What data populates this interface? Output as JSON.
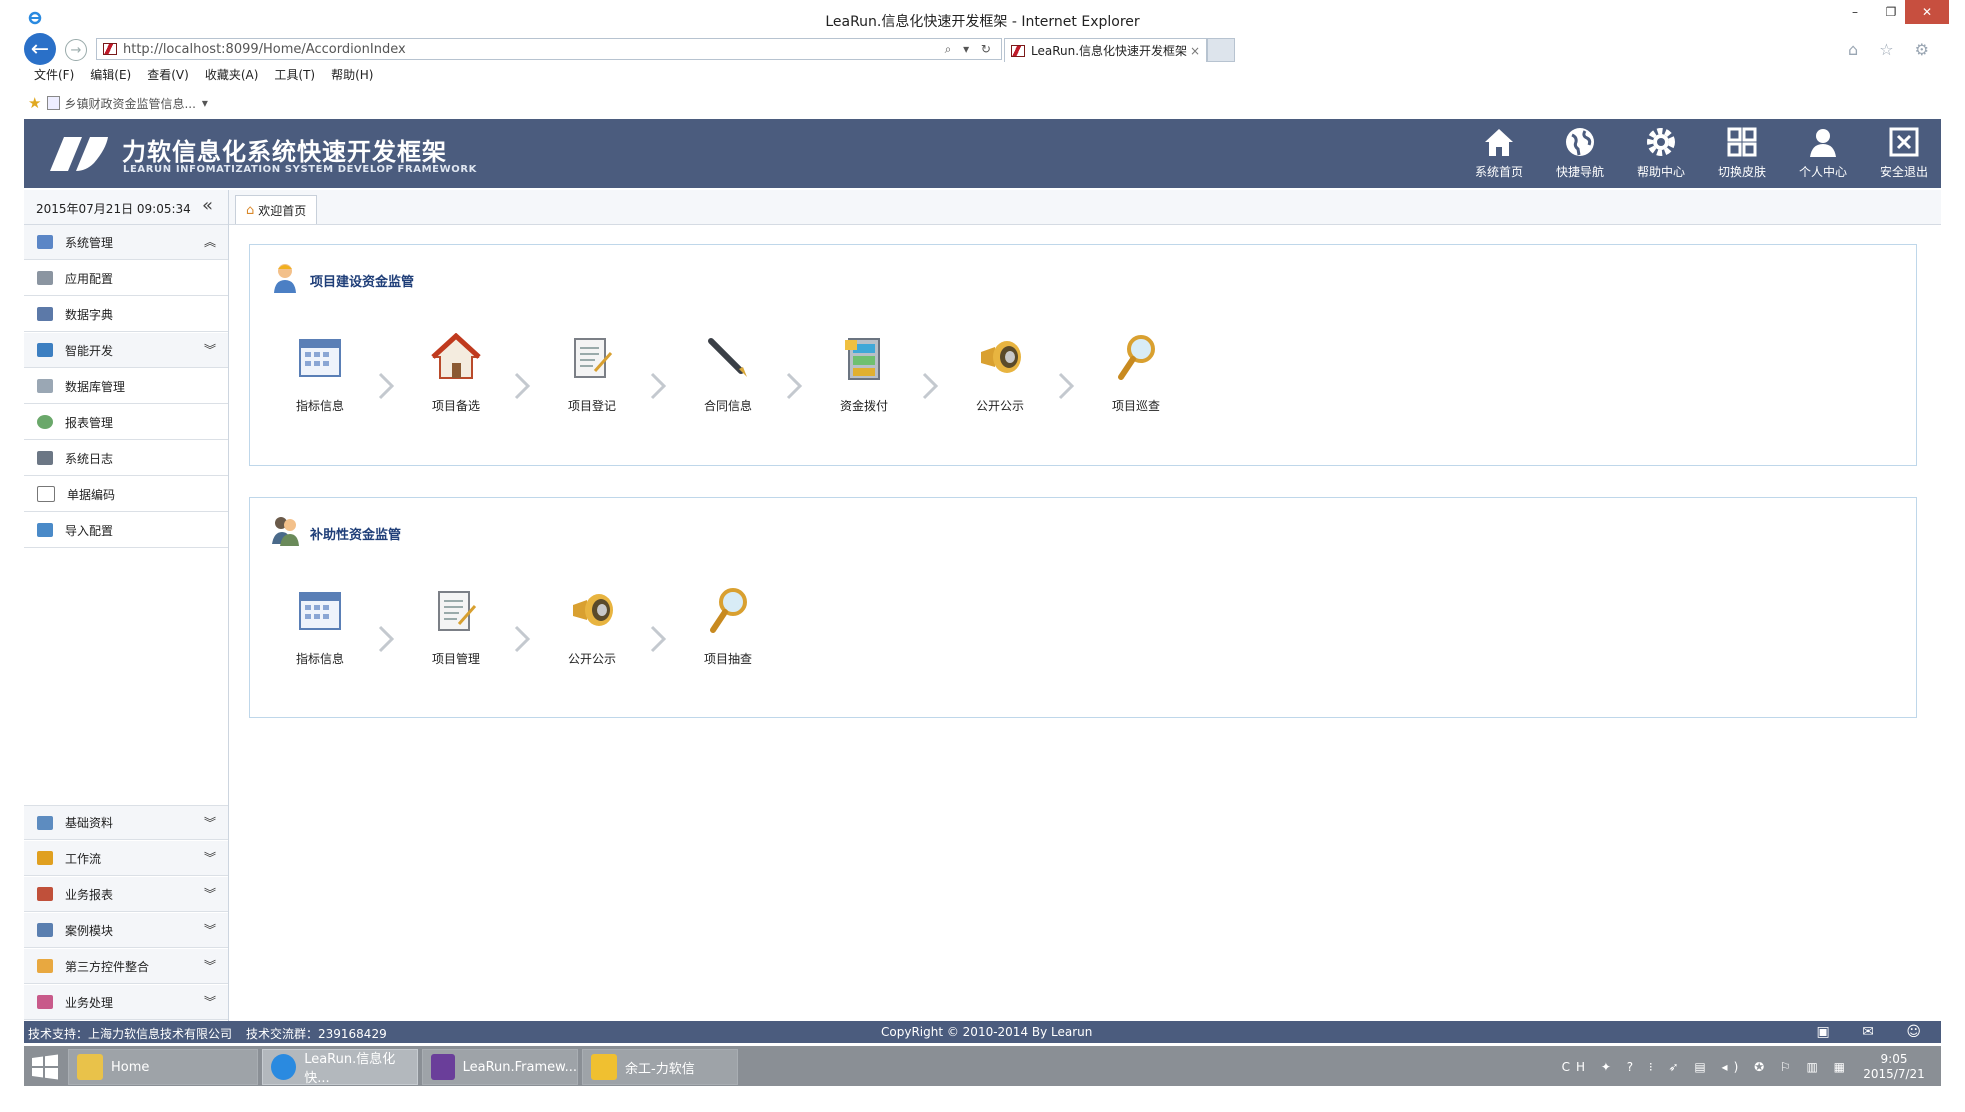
{
  "window": {
    "title": "LeaRun.信息化快速开发框架 - Internet Explorer",
    "controls": {
      "minimize": "–",
      "restore": "❐",
      "close": "✕"
    }
  },
  "browser": {
    "address": "http://localhost:8099/Home/AccordionIndex",
    "address_icons": "⌕ ▾ ↻",
    "tab_title": "LeaRun.信息化快速开发框架",
    "tab_close": "×",
    "right_icons": "⌂ ☆ ⚙",
    "menu": [
      "文件(F)",
      "编辑(E)",
      "查看(V)",
      "收藏夹(A)",
      "工具(T)",
      "帮助(H)"
    ],
    "favorite_link": "乡镇财政资金监管信息...",
    "favorite_dropdown": "▾"
  },
  "header": {
    "title": "力软信息化系统快速开发框架",
    "subtitle": "LEARUN INFOMATIZATION SYSTEM DEVELOP FRAMEWORK",
    "nav": [
      {
        "label": "系统首页",
        "icon": "home-icon"
      },
      {
        "label": "快捷导航",
        "icon": "globe-icon"
      },
      {
        "label": "帮助中心",
        "icon": "gear-icon"
      },
      {
        "label": "切换皮肤",
        "icon": "grid-icon"
      },
      {
        "label": "个人中心",
        "icon": "user-icon"
      },
      {
        "label": "安全退出",
        "icon": "exit-icon"
      }
    ]
  },
  "sidebar": {
    "datetime": "2015年07月21日 09:05:34",
    "collapse": "«",
    "items": [
      {
        "label": "系统管理",
        "chev": "︽"
      },
      {
        "label": "应用配置",
        "chev": ""
      },
      {
        "label": "数据字典",
        "chev": ""
      },
      {
        "label": "智能开发",
        "chev": "︾"
      },
      {
        "label": "数据库管理",
        "chev": ""
      },
      {
        "label": "报表管理",
        "chev": ""
      },
      {
        "label": "系统日志",
        "chev": ""
      },
      {
        "label": "单据编码",
        "chev": ""
      },
      {
        "label": "导入配置",
        "chev": ""
      }
    ],
    "bottom_items": [
      {
        "label": "基础资料",
        "chev": "︾"
      },
      {
        "label": "工作流",
        "chev": "︾"
      },
      {
        "label": "业务报表",
        "chev": "︾"
      },
      {
        "label": "案例模块",
        "chev": "︾"
      },
      {
        "label": "第三方控件整合",
        "chev": "︾"
      },
      {
        "label": "业务处理",
        "chev": "︾"
      }
    ]
  },
  "tabs": {
    "home": "欢迎首页"
  },
  "panels": [
    {
      "title": "项目建设资金监管",
      "steps": [
        "指标信息",
        "项目备选",
        "项目登记",
        "合同信息",
        "资金拨付",
        "公开公示",
        "项目巡查"
      ]
    },
    {
      "title": "补助性资金监管",
      "steps": [
        "指标信息",
        "项目管理",
        "公开公示",
        "项目抽查"
      ]
    }
  ],
  "statusbar": {
    "support": "技术支持：上海力软信息技术有限公司",
    "qq": "技术交流群：239168429",
    "copyright": "CopyRight © 2010-2014 By Learun",
    "icons": "▣ ✉ ☺"
  },
  "taskbar": {
    "items": [
      "Home",
      "LeaRun.信息化快...",
      "LeaRun.Framew...",
      "余工-力软信"
    ],
    "tray_icons": "CH ✦ ? ⁝ ➶ ▤ ◂) ✪ ⚐ ▥ ▦",
    "time": "9:05",
    "date": "2015/7/21"
  }
}
